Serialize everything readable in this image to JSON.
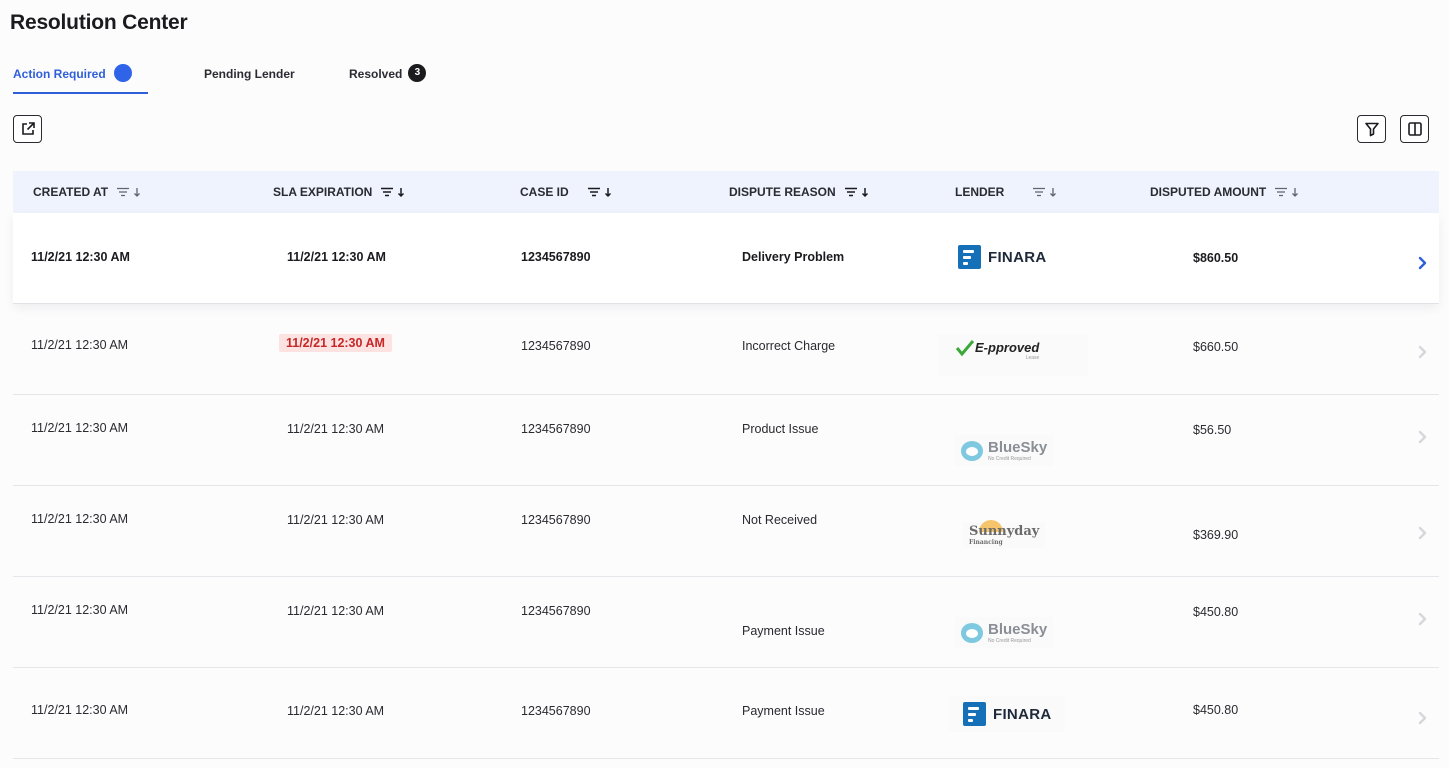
{
  "page": {
    "title": "Resolution Center"
  },
  "tabs": [
    {
      "label": "Action Required",
      "active": true
    },
    {
      "label": "Pending Lender"
    },
    {
      "label": "Resolved",
      "badge": "3"
    }
  ],
  "colors": {
    "accent": "#2f5fd8",
    "danger": "#c62828",
    "danger_bg": "#fde2e2",
    "header_bg": "#eef3fd"
  },
  "icons": {
    "export": "external-link-icon",
    "filter": "filter-icon",
    "columns": "columns-icon",
    "sort": "sort-lines-icon",
    "row_action": "chevron-right-icon"
  },
  "table": {
    "columns": [
      "CREATED AT",
      "SLA EXPIRATION",
      "CASE ID",
      "DISPUTE REASON",
      "LENDER",
      "DISPUTED AMOUNT"
    ],
    "rows": [
      {
        "created": "11/2/21 12:30 AM",
        "sla": "11/2/21 12:30 AM",
        "sla_expired": false,
        "case_id": "1234567890",
        "reason": "Delivery Problem",
        "lender": "FINARA",
        "lender_logo": "finara",
        "amount": "$860.50",
        "highlighted": true
      },
      {
        "created": "11/2/21 12:30 AM",
        "sla": "11/2/21 12:30 AM",
        "sla_expired": true,
        "case_id": "1234567890",
        "reason": "Incorrect Charge",
        "lender": "E-pproved",
        "lender_sub": "Lease",
        "lender_logo": "eproved",
        "amount": "$660.50"
      },
      {
        "created": "11/2/21 12:30 AM",
        "sla": "11/2/21 12:30 AM",
        "sla_expired": false,
        "case_id": "1234567890",
        "reason": "Product Issue",
        "lender": "BlueSky",
        "lender_sub": "No Credit Required",
        "lender_logo": "bluesky",
        "amount": "$56.50"
      },
      {
        "created": "11/2/21 12:30 AM",
        "sla": "11/2/21 12:30 AM",
        "sla_expired": false,
        "case_id": "1234567890",
        "reason": "Not Received",
        "lender": "Sunnyday",
        "lender_sub": "Financing",
        "lender_logo": "sunnyday",
        "amount": "$369.90"
      },
      {
        "created": "11/2/21 12:30 AM",
        "sla": "11/2/21 12:30 AM",
        "sla_expired": false,
        "case_id": "1234567890",
        "reason": "Payment Issue",
        "lender": "BlueSky",
        "lender_sub": "No Credit Required",
        "lender_logo": "bluesky",
        "amount": "$450.80"
      },
      {
        "created": "11/2/21 12:30 AM",
        "sla": "11/2/21 12:30 AM",
        "sla_expired": false,
        "case_id": "1234567890",
        "reason": "Payment Issue",
        "lender": "FINARA",
        "lender_logo": "finara",
        "amount": "$450.80"
      }
    ]
  }
}
